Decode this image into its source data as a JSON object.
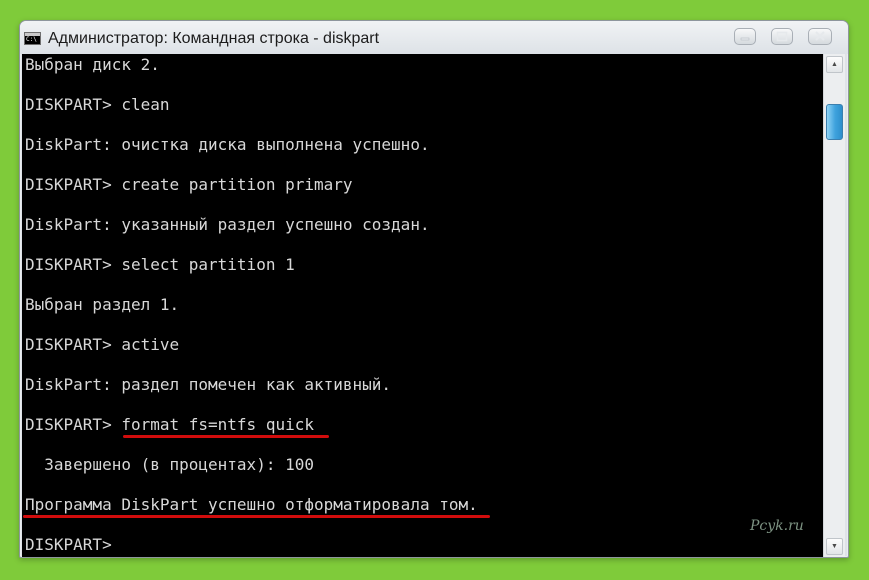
{
  "window": {
    "title": "Администратор: Командная строка - diskpart",
    "icon": "cmd-icon",
    "icon_glyph": "C:\\"
  },
  "titlebar_controls": [
    "minimize-icon",
    "maximize-icon",
    "close-icon"
  ],
  "console": {
    "lines": [
      "Выбран диск 2.",
      "DISKPART> clean",
      "DiskPart: очистка диска выполнена успешно.",
      "DISKPART> create partition primary",
      "DiskPart: указанный раздел успешно создан.",
      "DISKPART> select partition 1",
      "Выбран раздел 1.",
      "DISKPART> active",
      "DiskPart: раздел помечен как активный.",
      "DISKPART> format fs=ntfs quick",
      "  Завершено (в процентах): 100",
      "Программа DiskPart успешно отформатировала том.",
      "DISKPART>"
    ],
    "highlight_color": "#d10c0c",
    "text_color": "#d8d8d8",
    "background": "#000000"
  },
  "watermark": {
    "text": "Pcyk.ru"
  },
  "scrollbar": {
    "up_arrow": "▲",
    "down_arrow": "▼",
    "thumb_color": "#3ea2dd"
  }
}
